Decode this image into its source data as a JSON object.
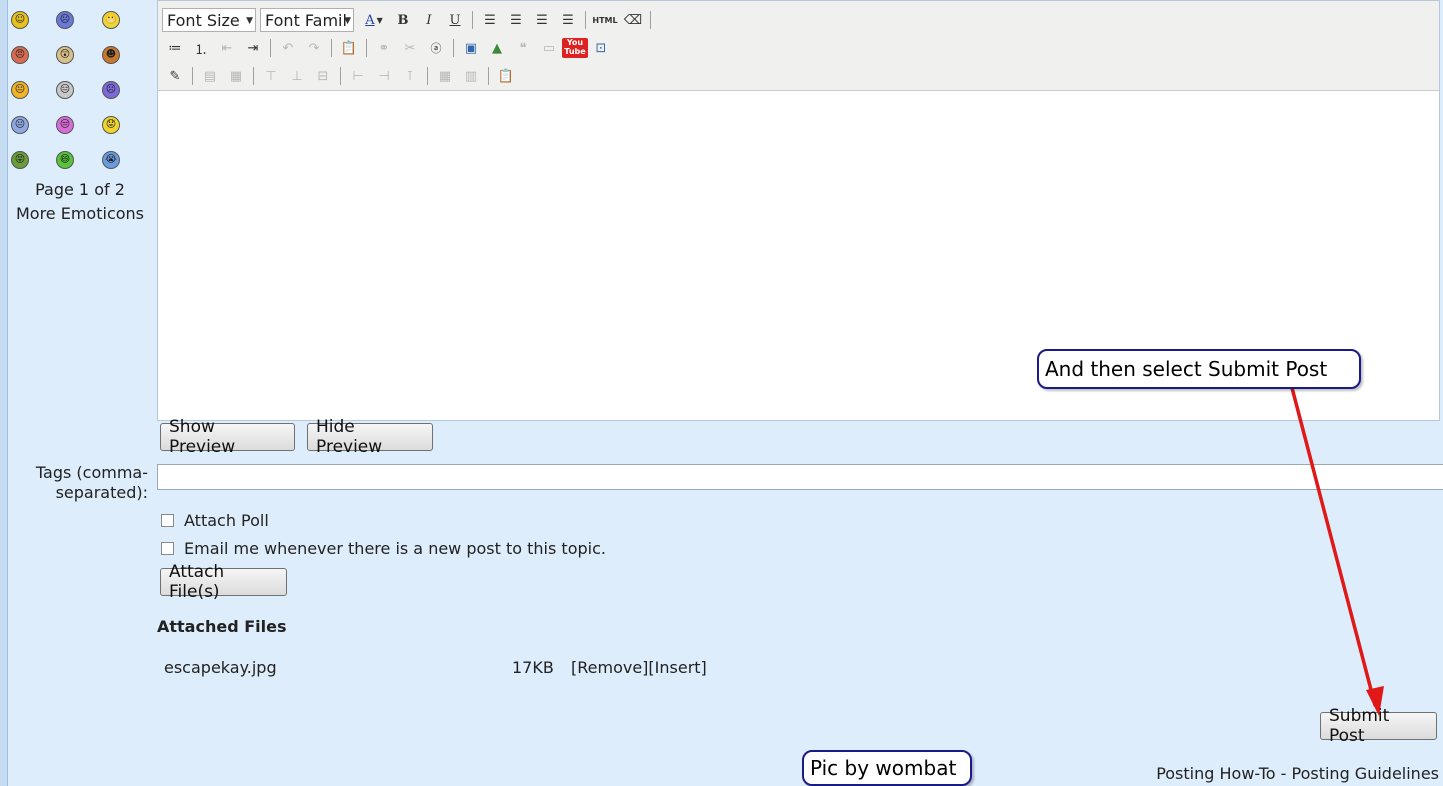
{
  "emoticons": {
    "faces": [
      "☺",
      "☹",
      "😬",
      "😠",
      "😲",
      "☻",
      "😐",
      "😑",
      "☹",
      "😐",
      "😒",
      "😟",
      "😝",
      "😄",
      "😭"
    ],
    "colors": [
      "#e8c21c",
      "#6a78d8",
      "#e8d73a",
      "#d86c52",
      "#d9c18c",
      "#c8782c",
      "#f1b428",
      "#c8c8c8",
      "#7c6ad8",
      "#8ea8e0",
      "#d86cd8",
      "#f0d42c",
      "#6a9c3c",
      "#58c43a",
      "#6a9ce0"
    ],
    "page_info": "Page 1 of 2",
    "more_label": "More Emoticons"
  },
  "toolbar": {
    "font_size_label": "Font Size",
    "font_family_label": "Font Famil",
    "html_label": "HTML",
    "youtube_top": "You",
    "youtube_bottom": "Tube"
  },
  "preview": {
    "show_label": "Show Preview",
    "hide_label": "Hide Preview"
  },
  "tags": {
    "label_line1": "Tags (comma-",
    "label_line2": "separated):",
    "value": ""
  },
  "options": {
    "attach_poll": "Attach Poll",
    "email_me": "Email me whenever there is a new post to this topic."
  },
  "attach_button": "Attach File(s)",
  "attached_files": {
    "title": "Attached Files",
    "files": [
      {
        "name": "escapekay.jpg",
        "size": "17KB",
        "remove": "[Remove]",
        "insert": "[Insert]"
      }
    ]
  },
  "submit_label": "Submit Post",
  "footer": {
    "howto": "Posting How-To",
    "separator": " - ",
    "guidelines": "Posting Guidelines"
  },
  "annotations": {
    "callout_text": "And then select Submit Post",
    "credit_text": "Pic by wombat",
    "arrow_color": "#e01818"
  }
}
